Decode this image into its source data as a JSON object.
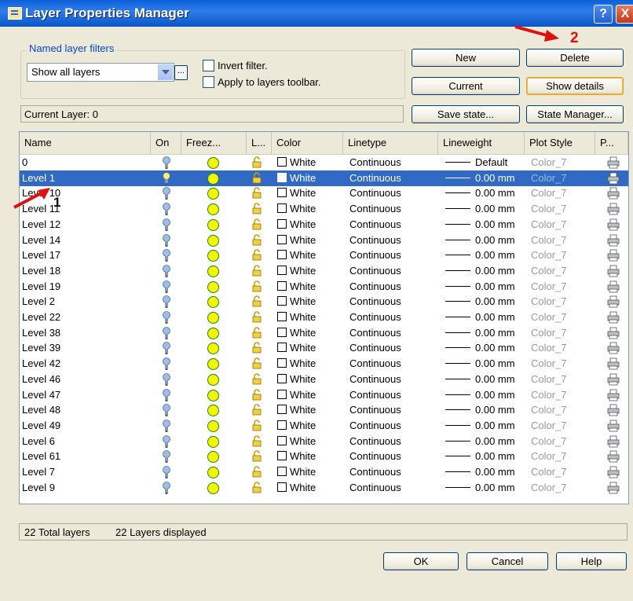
{
  "title": "Layer Properties Manager",
  "titlebar_buttons": {
    "help": "?",
    "close": "X"
  },
  "filters": {
    "group_label": "Named layer filters",
    "selected": "Show all layers",
    "browse_label": "...",
    "invert_label": "Invert filter.",
    "apply_label": "Apply to layers toolbar.",
    "invert_checked": false,
    "apply_checked": false
  },
  "buttons": {
    "new": "New",
    "delete": "Delete",
    "current": "Current",
    "show_details": "Show details",
    "save_state": "Save state...",
    "state_manager": "State Manager..."
  },
  "current_layer": "Current Layer:  0",
  "columns": [
    "Name",
    "On",
    "Freez...",
    "L...",
    "Color",
    "Linetype",
    "Lineweight",
    "Plot Style",
    "P..."
  ],
  "layers": [
    {
      "name": "0",
      "color": "White",
      "linetype": "Continuous",
      "lineweight": "Default",
      "plot_style": "Color_7"
    },
    {
      "name": "Level 1",
      "color": "White",
      "linetype": "Continuous",
      "lineweight": "0.00 mm",
      "plot_style": "Color_7",
      "selected": true
    },
    {
      "name": "Level 10",
      "color": "White",
      "linetype": "Continuous",
      "lineweight": "0.00 mm",
      "plot_style": "Color_7"
    },
    {
      "name": "Level 11",
      "color": "White",
      "linetype": "Continuous",
      "lineweight": "0.00 mm",
      "plot_style": "Color_7"
    },
    {
      "name": "Level 12",
      "color": "White",
      "linetype": "Continuous",
      "lineweight": "0.00 mm",
      "plot_style": "Color_7"
    },
    {
      "name": "Level 14",
      "color": "White",
      "linetype": "Continuous",
      "lineweight": "0.00 mm",
      "plot_style": "Color_7"
    },
    {
      "name": "Level 17",
      "color": "White",
      "linetype": "Continuous",
      "lineweight": "0.00 mm",
      "plot_style": "Color_7"
    },
    {
      "name": "Level 18",
      "color": "White",
      "linetype": "Continuous",
      "lineweight": "0.00 mm",
      "plot_style": "Color_7"
    },
    {
      "name": "Level 19",
      "color": "White",
      "linetype": "Continuous",
      "lineweight": "0.00 mm",
      "plot_style": "Color_7"
    },
    {
      "name": "Level 2",
      "color": "White",
      "linetype": "Continuous",
      "lineweight": "0.00 mm",
      "plot_style": "Color_7"
    },
    {
      "name": "Level 22",
      "color": "White",
      "linetype": "Continuous",
      "lineweight": "0.00 mm",
      "plot_style": "Color_7"
    },
    {
      "name": "Level 38",
      "color": "White",
      "linetype": "Continuous",
      "lineweight": "0.00 mm",
      "plot_style": "Color_7"
    },
    {
      "name": "Level 39",
      "color": "White",
      "linetype": "Continuous",
      "lineweight": "0.00 mm",
      "plot_style": "Color_7"
    },
    {
      "name": "Level 42",
      "color": "White",
      "linetype": "Continuous",
      "lineweight": "0.00 mm",
      "plot_style": "Color_7"
    },
    {
      "name": "Level 46",
      "color": "White",
      "linetype": "Continuous",
      "lineweight": "0.00 mm",
      "plot_style": "Color_7"
    },
    {
      "name": "Level 47",
      "color": "White",
      "linetype": "Continuous",
      "lineweight": "0.00 mm",
      "plot_style": "Color_7"
    },
    {
      "name": "Level 48",
      "color": "White",
      "linetype": "Continuous",
      "lineweight": "0.00 mm",
      "plot_style": "Color_7"
    },
    {
      "name": "Level 49",
      "color": "White",
      "linetype": "Continuous",
      "lineweight": "0.00 mm",
      "plot_style": "Color_7"
    },
    {
      "name": "Level 6",
      "color": "White",
      "linetype": "Continuous",
      "lineweight": "0.00 mm",
      "plot_style": "Color_7"
    },
    {
      "name": "Level 61",
      "color": "White",
      "linetype": "Continuous",
      "lineweight": "0.00 mm",
      "plot_style": "Color_7"
    },
    {
      "name": "Level 7",
      "color": "White",
      "linetype": "Continuous",
      "lineweight": "0.00 mm",
      "plot_style": "Color_7"
    },
    {
      "name": "Level 9",
      "color": "White",
      "linetype": "Continuous",
      "lineweight": "0.00 mm",
      "plot_style": "Color_7"
    }
  ],
  "status": {
    "total": "22 Total layers",
    "displayed": "22 Layers displayed"
  },
  "footer": {
    "ok": "OK",
    "cancel": "Cancel",
    "help": "Help"
  },
  "annotations": {
    "label_1": "1",
    "label_2": "2"
  },
  "colors": {
    "titlebar": "#0a5fd8",
    "selection": "#316ac5",
    "annotation_arrow": "#e01010",
    "dialog_bg": "#ece9d8"
  },
  "icons": {
    "on": "lightbulb-icon",
    "freeze": "sun-icon",
    "lock": "padlock-icon",
    "plot": "printer-icon"
  }
}
